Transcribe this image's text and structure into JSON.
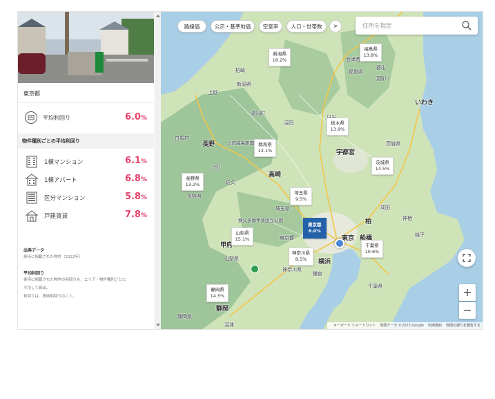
{
  "panel": {
    "region": "東京都",
    "avg": {
      "label": "平均利回り",
      "value": "6.0",
      "unit": "%"
    },
    "type_header": "物件種別ごとの平均利回り",
    "types": [
      {
        "label": "1棟マンション",
        "value": "6.1",
        "unit": "%",
        "icon": "building-icon"
      },
      {
        "label": "1棟アパート",
        "value": "6.8",
        "unit": "%",
        "icon": "apartment-icon"
      },
      {
        "label": "区分マンション",
        "value": "5.8",
        "unit": "%",
        "icon": "condo-icon"
      },
      {
        "label": "戸建賃貸",
        "value": "7.8",
        "unit": "%",
        "icon": "house-icon"
      }
    ],
    "notes": {
      "source_title": "出典データ",
      "source_text": "楽待に掲載された物件（2022年）",
      "avg_title": "平均利回り",
      "avg_text_1": "楽待に掲載された物件の利回りを、エリア・物件種別ごとに",
      "avg_text_2": "平均して算出。",
      "avg_text_3": "利回りは、表面利回りのこと。"
    }
  },
  "map": {
    "chips": [
      "路線価",
      "公示・基準地価",
      "空室率",
      "人口・世帯数"
    ],
    "chip_next": ">",
    "search_placeholder": "住所を指定",
    "zoom_in": "+",
    "zoom_out": "−",
    "attribution": [
      "キーボード ショートカット",
      "地図データ ©2023 Google",
      "利用規約",
      "地図の誤りを報告する"
    ],
    "prefectures": [
      {
        "name": "新潟県",
        "value": "18.2%"
      },
      {
        "name": "福島県",
        "value": "13.8%"
      },
      {
        "name": "栃木県",
        "value": "13.9%"
      },
      {
        "name": "群馬県",
        "value": "13.1%"
      },
      {
        "name": "長野県",
        "value": "13.2%"
      },
      {
        "name": "茨城県",
        "value": "14.5%"
      },
      {
        "name": "埼玉県",
        "value": "9.5%"
      },
      {
        "name": "山梨県",
        "value": "15.1%"
      },
      {
        "name": "東京都",
        "value": "6.0%"
      },
      {
        "name": "神奈川県",
        "value": "8.5%"
      },
      {
        "name": "千葉県",
        "value": "10.6%"
      },
      {
        "name": "静岡県",
        "value": "14.5%"
      }
    ],
    "places": {
      "kashiwazaki": "柏崎",
      "niigata": "新潟県",
      "joetsu": "上越",
      "aizu": "会津若松",
      "fukushima": "福島県",
      "koriyama": "郡山",
      "sukagawa": "須賀川",
      "iwaki": "いわき",
      "hakuba": "白馬村",
      "nagano_city": "長野",
      "joshinetsu": "上信越高原国立公園",
      "numata": "沼田",
      "yuzawa": "湯沢町",
      "nikko": "日光",
      "utsunomiya": "宇都宮",
      "ibaraki": "茨城県",
      "takasaki": "高崎",
      "ueda": "上田",
      "saku": "佐久",
      "nagano_ken": "長野県",
      "saitama": "埼玉県",
      "chichibu": "秩父多摩甲斐国立公園",
      "kofu": "甲府",
      "tokyo": "東京",
      "tokyo_to": "東京都",
      "funabashi": "船橋",
      "kashiwa": "柏",
      "yokohama": "横浜",
      "kanagawa": "神奈川県",
      "kamakura": "鎌倉",
      "yamanashi": "山梨県",
      "chiba": "千葉県",
      "shizuoka": "静岡",
      "shizuoka_ken": "静岡県",
      "numazu": "沼津",
      "choshi": "銚子",
      "narita": "成田",
      "kamisu": "神栖"
    }
  },
  "colors": {
    "accent": "#e8446c",
    "active_card": "#2461a8",
    "land": "#cfe3b9",
    "mountain": "#9fc59a",
    "water": "#a9cfe6",
    "road": "#f3c548"
  }
}
